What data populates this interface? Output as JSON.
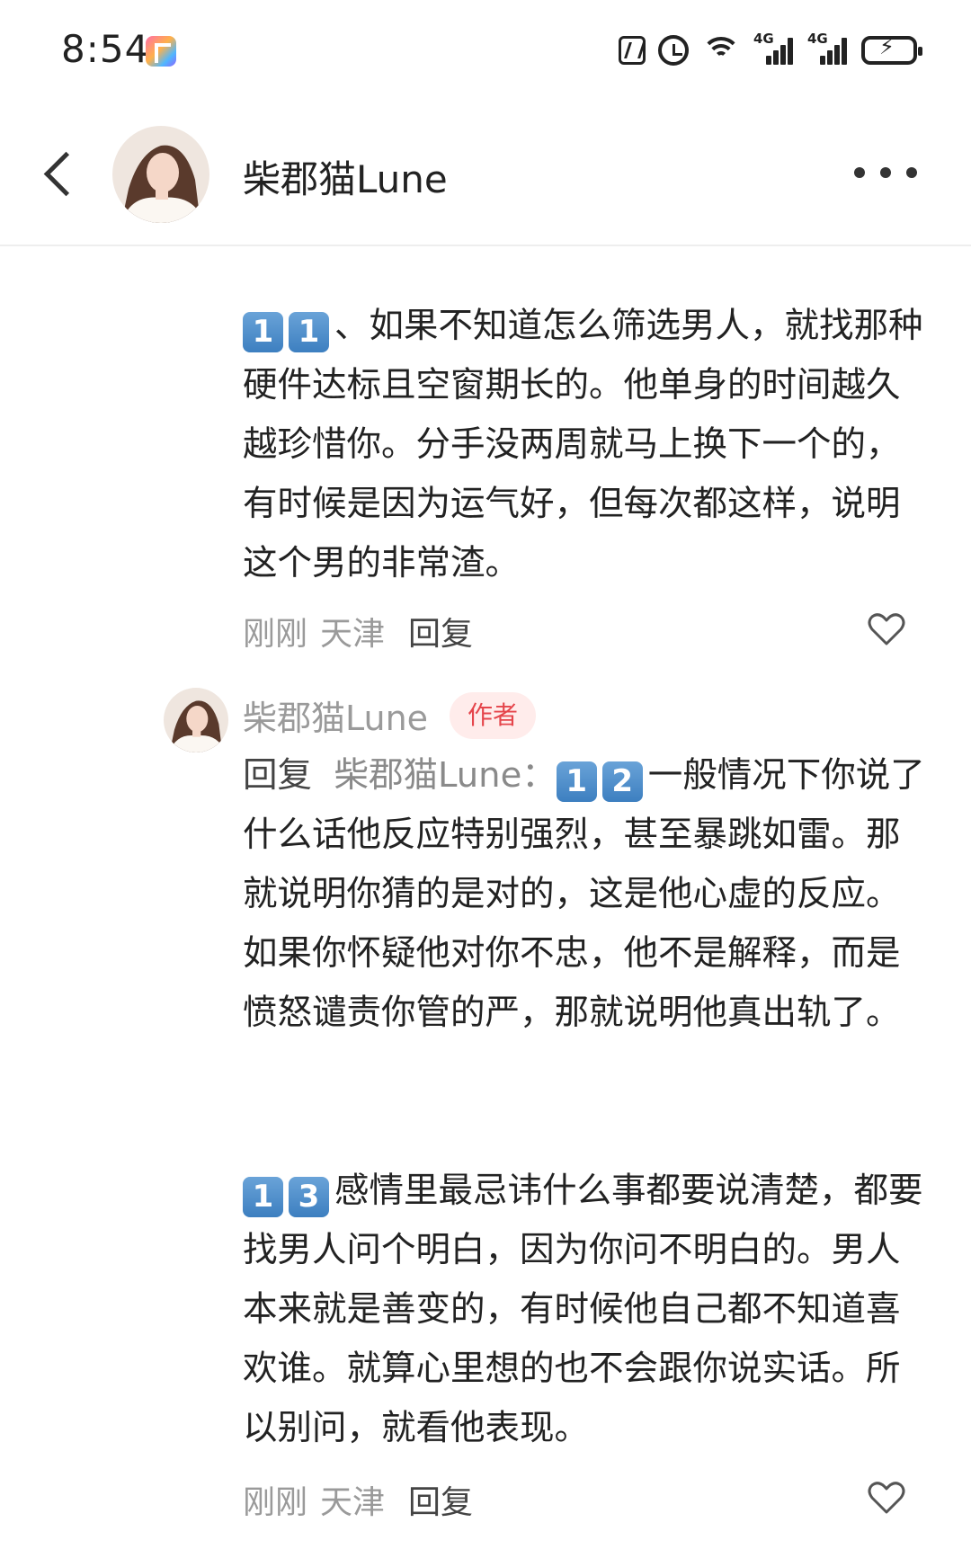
{
  "status_bar": {
    "time": "8:54",
    "network_1": "4G",
    "network_2": "4G"
  },
  "header": {
    "username": "柴郡猫Lune"
  },
  "comments": [
    {
      "number": [
        "1",
        "1"
      ],
      "separator": "、",
      "text": "如果不知道怎么筛选男人，就找那种硬件达标且空窗期长的。他单身的时间越久越珍惜你。分手没两周就马上换下一个的，有时候是因为运气好，但每次都这样，说明这个男的非常渣。",
      "time": "刚刚",
      "location": "天津",
      "reply_label": "回复"
    },
    {
      "username": "柴郡猫Lune",
      "badge": "作者",
      "reply_prefix": "回复",
      "reply_target": "柴郡猫Lune：",
      "number": [
        "1",
        "2"
      ],
      "text": "一般情况下你说了什么话他反应特别强烈，甚至暴跳如雷。那就说明你猜的是对的，这是他心虚的反应。如果你怀疑他对你不忠，他不是解释，而是愤怒谴责你管的严，那就说明他真出轨了。",
      "number_2": [
        "1",
        "3"
      ],
      "text_2": "感情里最忌讳什么事都要说清楚，都要找男人问个明白，因为你问不明白的。男人本来就是善变的，有时候他自己都不知道喜欢谁。就算心里想的也不会跟你说实话。所以别问，就看他表现。",
      "time": "刚刚",
      "location": "天津",
      "reply_label": "回复"
    }
  ],
  "colors": {
    "badge_bg": "#ffeceb",
    "badge_text": "#e5454b",
    "meta_text": "#9a9a9a",
    "keycap": "#3d7fc0"
  },
  "icons": [
    "back-icon",
    "more-icon",
    "heart-icon",
    "nfc-icon",
    "alarm-icon",
    "wifi-icon",
    "signal-icon",
    "battery-icon"
  ]
}
